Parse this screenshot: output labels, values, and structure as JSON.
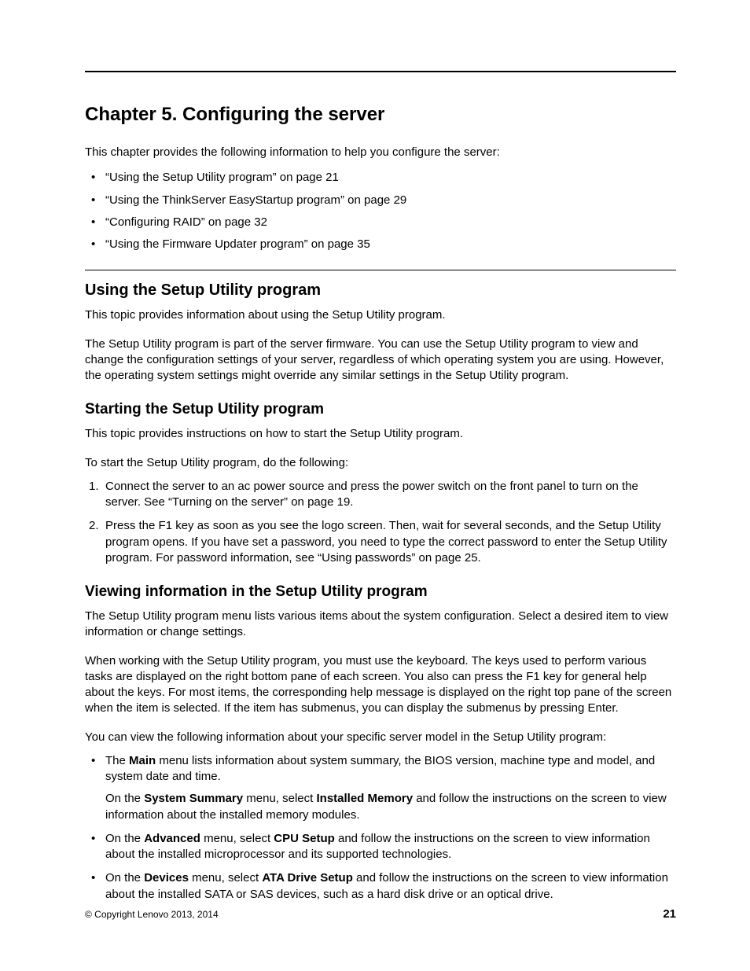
{
  "chapter_title": "Chapter 5.   Configuring the server",
  "intro": "This chapter provides the following information to help you configure the server:",
  "toc": [
    "“Using the Setup Utility program” on page 21",
    "“Using the ThinkServer EasyStartup program” on page 29",
    "“Configuring RAID” on page 32",
    "“Using the Firmware Updater program” on page 35"
  ],
  "section1": {
    "heading": "Using the Setup Utility program",
    "p1": "This topic provides information about using the Setup Utility program.",
    "p2": "The Setup Utility program is part of the server firmware. You can use the Setup Utility program to view and change the configuration settings of your server, regardless of which operating system you are using. However, the operating system settings might override any similar settings in the Setup Utility program."
  },
  "section2": {
    "heading": "Starting the Setup Utility program",
    "p1": "This topic provides instructions on how to start the Setup Utility program.",
    "p2": "To start the Setup Utility program, do the following:",
    "steps": [
      "Connect the server to an ac power source and press the power switch on the front panel to turn on the server. See “Turning on the server” on page 19.",
      "Press the F1 key as soon as you see the logo screen. Then, wait for several seconds, and the Setup Utility program opens. If you have set a password, you need to type the correct password to enter the Setup Utility program. For password information, see “Using passwords” on page 25."
    ]
  },
  "section3": {
    "heading": "Viewing information in the Setup Utility program",
    "p1": "The Setup Utility program menu lists various items about the system configuration. Select a desired item to view information or change settings.",
    "p2": "When working with the Setup Utility program, you must use the keyboard. The keys used to perform various tasks are displayed on the right bottom pane of each screen. You also can press the F1 key for general help about the keys. For most items, the corresponding help message is displayed on the right top pane of the screen when the item is selected. If the item has submenus, you can display the submenus by pressing Enter.",
    "p3": "You can view the following information about your specific server model in the Setup Utility program:",
    "bullets": {
      "b1_pre": "The ",
      "b1_bold": "Main",
      "b1_post": " menu lists information about system summary, the BIOS version, machine type and model, and system date and time.",
      "b1_sub_pre": "On the ",
      "b1_sub_bold1": "System Summary",
      "b1_sub_mid": " menu, select ",
      "b1_sub_bold2": "Installed Memory",
      "b1_sub_post": " and follow the instructions on the screen to view information about the installed memory modules.",
      "b2_pre": "On the ",
      "b2_bold1": "Advanced",
      "b2_mid": " menu, select ",
      "b2_bold2": "CPU Setup",
      "b2_post": " and follow the instructions on the screen to view information about the installed microprocessor and its supported technologies.",
      "b3_pre": "On the ",
      "b3_bold1": "Devices",
      "b3_mid": " menu, select ",
      "b3_bold2": "ATA Drive Setup",
      "b3_post": " and follow the instructions on the screen to view information about the installed SATA or SAS devices, such as a hard disk drive or an optical drive."
    }
  },
  "footer": {
    "copyright": "© Copyright Lenovo 2013, 2014",
    "page": "21"
  }
}
